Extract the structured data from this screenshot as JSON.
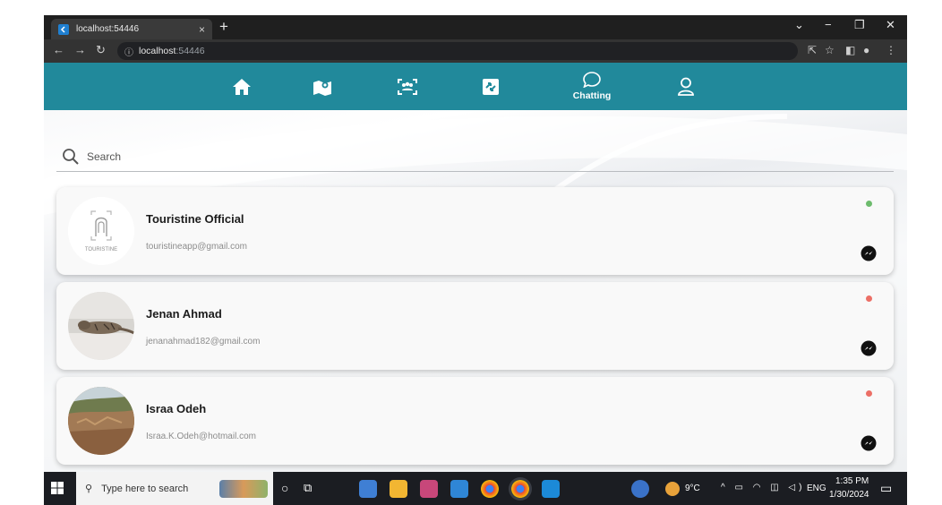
{
  "browser": {
    "tab_title": "localhost:54446",
    "tab_close": "×",
    "new_tab": "+",
    "url_host": "localhost",
    "url_port": ":54446"
  },
  "nav": {
    "items": [
      {
        "icon": "home-icon",
        "label": ""
      },
      {
        "icon": "map-icon",
        "label": ""
      },
      {
        "icon": "group-icon",
        "label": ""
      },
      {
        "icon": "gallery-icon",
        "label": ""
      },
      {
        "icon": "chat-icon",
        "label": "Chatting"
      },
      {
        "icon": "profile-icon",
        "label": ""
      }
    ],
    "active": "Chatting",
    "color": "#21899b"
  },
  "search": {
    "placeholder": "Search"
  },
  "contacts": [
    {
      "name": "Touristine Official",
      "email": "touristineapp@gmail.com",
      "online": true,
      "avatar": "touristine-logo",
      "logo_text": "TOURISTINE"
    },
    {
      "name": "Jenan Ahmad",
      "email": "jenanahmad182@gmail.com",
      "online": false,
      "avatar": "cat-photo"
    },
    {
      "name": "Israa Odeh",
      "email": "Israa.K.Odeh@hotmail.com",
      "online": false,
      "avatar": "landscape-photo"
    }
  ],
  "status_colors": {
    "online": "#6dbb6d",
    "offline": "#ec6f66"
  },
  "taskbar": {
    "search_placeholder": "Type here to search",
    "temperature": "9°C",
    "language": "ENG",
    "time": "1:35 PM",
    "date": "1/30/2024"
  }
}
